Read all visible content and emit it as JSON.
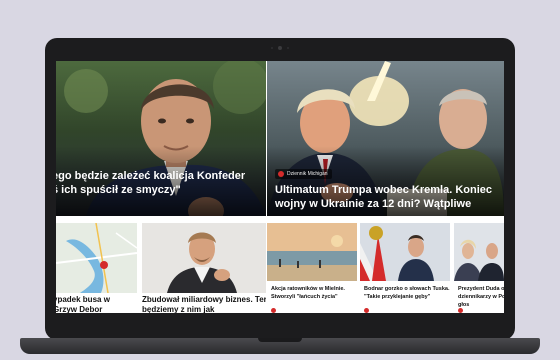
{
  "hero": {
    "left_title_line1": "ego będzie zależeć koalicja Konfeder",
    "left_title_line2": "ś ich spuścił ze smyczy\"",
    "right_source": "Dziennik Michigan",
    "right_title": "Ultimatum Trumpa wobec Kremla. Koniec wojny w Ukrainie za 12 dni? Wątpliwe"
  },
  "cards": [
    {
      "caption_line1": "ypadek busa w",
      "caption_line2": "Grzyw Debor"
    },
    {
      "caption_line1": "Zbudował miliardowy biznes. Teraz",
      "caption_line2": "będziemy z nim jak"
    },
    {
      "caption_line1": "Akcja ratowników w Mielnie.",
      "caption_line2": "Stworzyli \"łańcuch życia\""
    },
    {
      "caption_line1": "Bodnar gorzko o słowach Tuska.",
      "caption_line2": "\"Takie przyklejanie gęby\""
    },
    {
      "caption_line1": "Prezydent Duda od",
      "caption_line2": "dziennikarzy w Pol",
      "caption_line3": "głos"
    }
  ]
}
